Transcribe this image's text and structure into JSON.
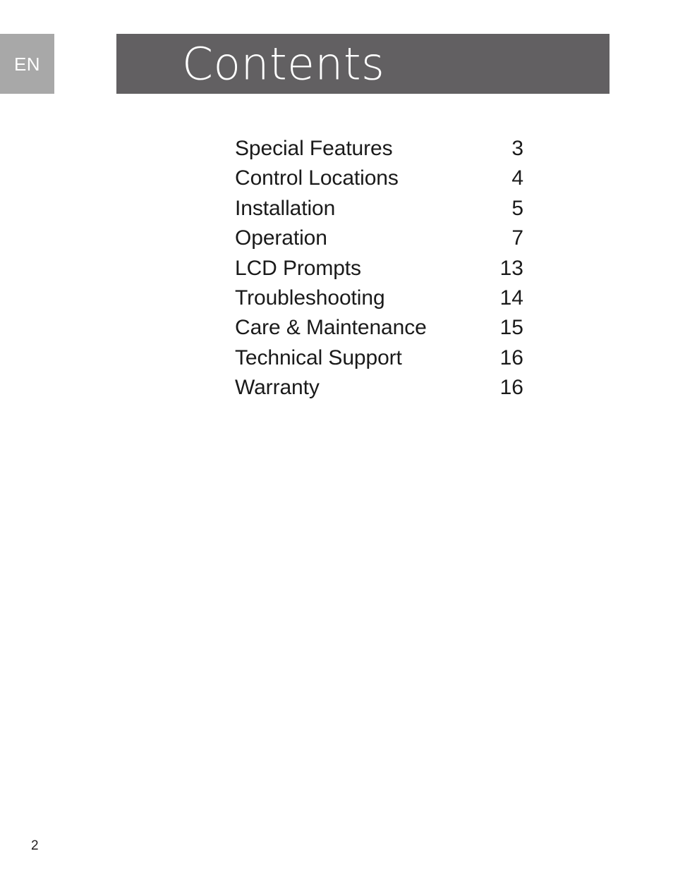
{
  "page": {
    "background_color": "#ffffff",
    "folio_number": "2"
  },
  "header": {
    "language_tab": {
      "label": "EN",
      "background_color": "#a8a8a8",
      "text_color": "#ffffff"
    },
    "title": "Contents",
    "bar_color": "#626062",
    "title_color": "#ffffff"
  },
  "contents": {
    "text_color": "#1a1a1a",
    "entries": [
      {
        "title": "Special Features",
        "page": "3"
      },
      {
        "title": "Control Locations",
        "page": "4"
      },
      {
        "title": "Installation",
        "page": "5"
      },
      {
        "title": "Operation",
        "page": "7"
      },
      {
        "title": "LCD Prompts",
        "page": "13"
      },
      {
        "title": "Troubleshooting",
        "page": "14"
      },
      {
        "title": "Care & Maintenance",
        "page": "15"
      },
      {
        "title": "Technical Support",
        "page": "16"
      },
      {
        "title": "Warranty",
        "page": "16"
      }
    ]
  }
}
